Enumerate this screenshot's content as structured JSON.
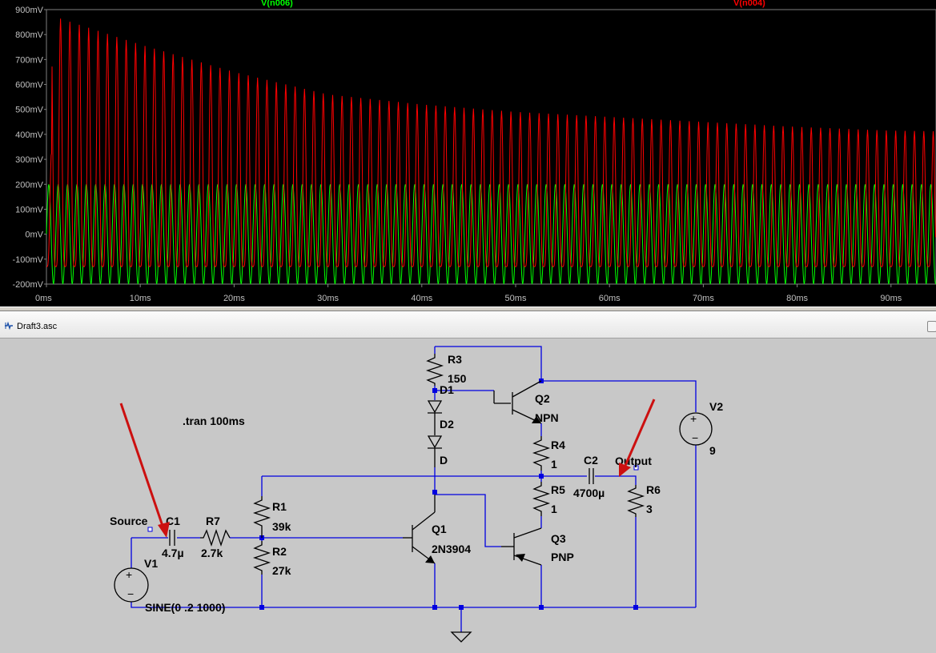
{
  "plot": {
    "background": "#000000",
    "y_ticks": [
      "900mV",
      "800mV",
      "700mV",
      "600mV",
      "500mV",
      "400mV",
      "300mV",
      "200mV",
      "100mV",
      "0mV",
      "-100mV",
      "-200mV"
    ],
    "x_ticks": [
      "0ms",
      "10ms",
      "20ms",
      "30ms",
      "40ms",
      "50ms",
      "60ms",
      "70ms",
      "80ms",
      "90ms"
    ],
    "traces": [
      {
        "name": "V(n006)",
        "color": "#00ff00"
      },
      {
        "name": "V(n004)",
        "color": "#ff0000"
      }
    ]
  },
  "chart_data": {
    "type": "line",
    "xlabel": "",
    "ylabel": "",
    "xlim": [
      0,
      100
    ],
    "ylim": [
      -200,
      900
    ],
    "x_unit": "ms",
    "y_unit": "mV",
    "frequency_hz": 1000,
    "series": [
      {
        "name": "V(n006)",
        "color": "#00ff00",
        "kind": "sine",
        "amplitude_mV": 200,
        "offset_mV": 0
      },
      {
        "name": "V(n004)",
        "color": "#ff0000",
        "kind": "decaying-sine",
        "peaks_mV": [
          [
            1,
            870
          ],
          [
            10,
            760
          ],
          [
            20,
            650
          ],
          [
            30,
            560
          ],
          [
            40,
            520
          ],
          [
            50,
            490
          ],
          [
            60,
            470
          ],
          [
            70,
            450
          ],
          [
            80,
            430
          ],
          [
            90,
            415
          ],
          [
            99,
            410
          ]
        ],
        "minimum_mV": -130
      }
    ]
  },
  "tab": {
    "title": "Draft3.asc"
  },
  "schematic": {
    "directive": ".tran 100ms",
    "net_labels": {
      "source": "Source",
      "output": "Output"
    },
    "components": {
      "R3": {
        "ref": "R3",
        "value": "150"
      },
      "D1": {
        "ref": "D1"
      },
      "D2": {
        "ref": "D2",
        "value": "D"
      },
      "Q2": {
        "ref": "Q2",
        "value": "NPN"
      },
      "R4": {
        "ref": "R4",
        "value": "1"
      },
      "C2": {
        "ref": "C2",
        "value": "4700µ"
      },
      "R5": {
        "ref": "R5",
        "value": "1"
      },
      "R6": {
        "ref": "R6",
        "value": "3"
      },
      "V2": {
        "ref": "V2",
        "value": "9"
      },
      "R1": {
        "ref": "R1",
        "value": "39k"
      },
      "R2": {
        "ref": "R2",
        "value": "27k"
      },
      "Q1": {
        "ref": "Q1",
        "value": "2N3904"
      },
      "Q3": {
        "ref": "Q3",
        "value": "PNP"
      },
      "C1": {
        "ref": "C1",
        "value": "4.7µ"
      },
      "R7": {
        "ref": "R7",
        "value": "2.7k"
      },
      "V1": {
        "ref": "V1",
        "value": "SINE(0 .2 1000)"
      }
    },
    "annotation_color": "#cc1010"
  }
}
